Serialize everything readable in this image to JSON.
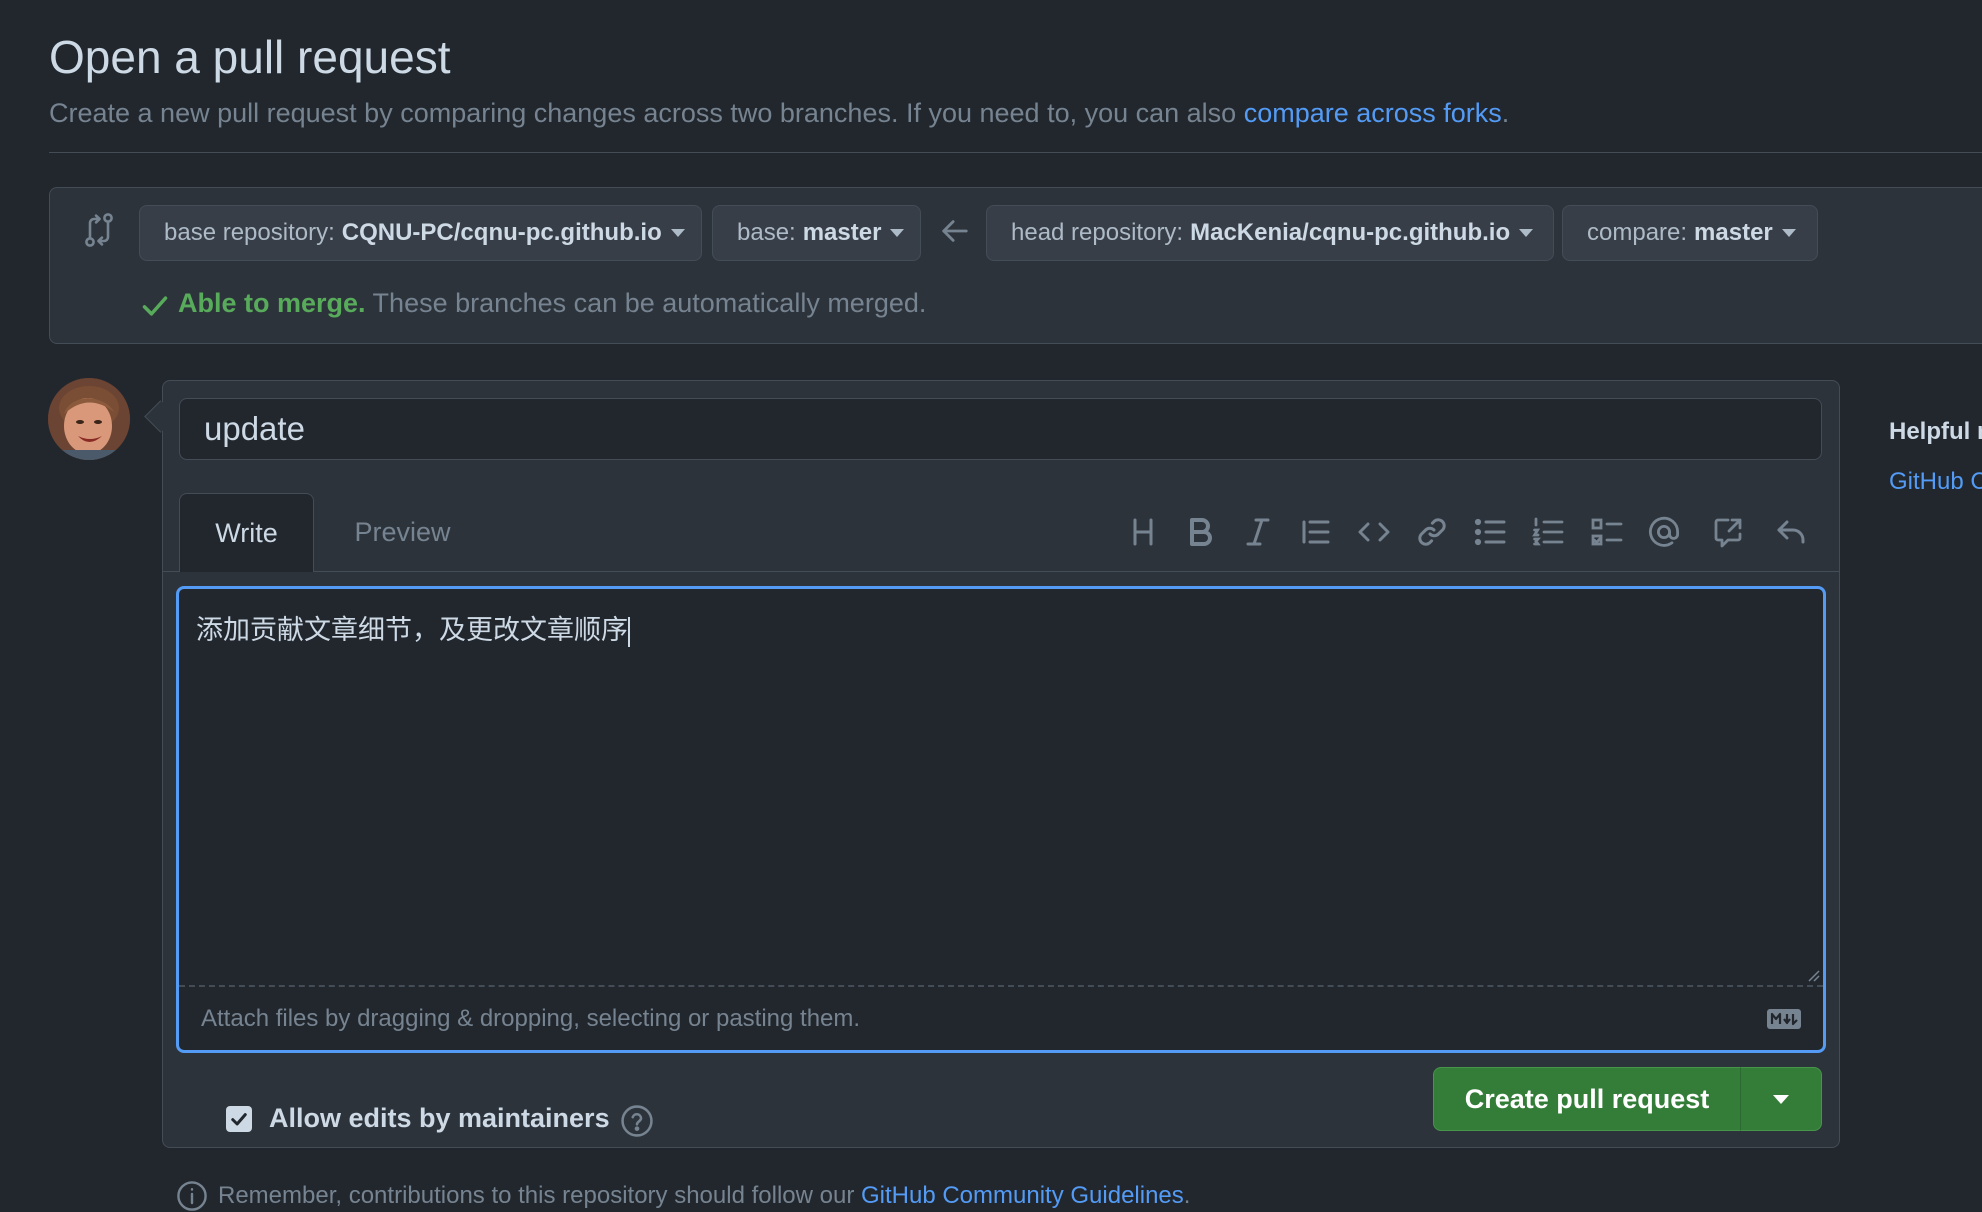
{
  "header": {
    "title": "Open a pull request",
    "subtitle_prefix": "Create a new pull request by comparing changes across two branches. If you need to, you can also ",
    "subtitle_link": "compare across forks",
    "subtitle_suffix": "."
  },
  "compare": {
    "base_repo_label": "base repository:",
    "base_repo_value": "CQNU-PC/cqnu-pc.github.io",
    "base_label": "base:",
    "base_value": "master",
    "head_repo_label": "head repository:",
    "head_repo_value": "MacKenia/cqnu-pc.github.io",
    "compare_label": "compare:",
    "compare_value": "master",
    "merge_status_strong": "Able to merge.",
    "merge_status_text": " These branches can be automatically merged."
  },
  "form": {
    "title_value": "update",
    "tab_write": "Write",
    "tab_preview": "Preview",
    "body_value": "添加贡献文章细节，及更改文章顺序",
    "attach_text": "Attach files by dragging & dropping, selecting or pasting them.",
    "allow_edits_label": "Allow edits by maintainers",
    "allow_edits_checked": true,
    "create_button": "Create pull request"
  },
  "toolbar": {
    "icons": [
      "heading-icon",
      "bold-icon",
      "italic-icon",
      "quote-icon",
      "code-icon",
      "link-icon",
      "unordered-list-icon",
      "ordered-list-icon",
      "task-list-icon",
      "mention-icon",
      "cross-reference-icon",
      "reply-icon"
    ]
  },
  "footer": {
    "note_prefix": "Remember, contributions to this repository should follow our ",
    "note_link": "GitHub Community Guidelines",
    "note_suffix": "."
  },
  "sidebar": {
    "heading": "Helpful r",
    "link": "GitHub C"
  },
  "colors": {
    "background": "#22272e",
    "panel": "#2d333b",
    "accent_blue": "#539bf5",
    "success_green": "#57ab5a",
    "button_green": "#347d39"
  }
}
